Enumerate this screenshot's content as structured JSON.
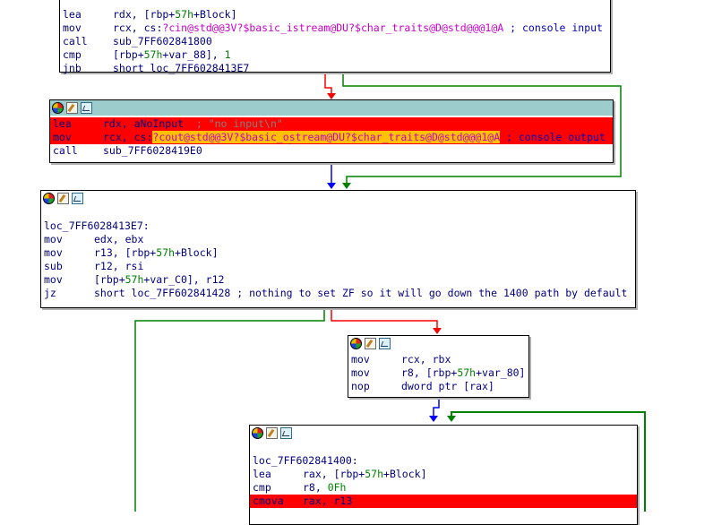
{
  "colors": {
    "red_edge": "#ff0000",
    "green_edge": "#008000",
    "blue_edge": "#0000ff",
    "highlight": "#ffc000",
    "red_line": "#ff0000",
    "header_teal": "#9ccccc"
  },
  "header_icons": [
    "color-icon",
    "rename-icon",
    "graph-overview-icon"
  ],
  "block1": {
    "lines": [
      {
        "mn": "lea",
        "a": "rdx, [rbp+",
        "n": "57h",
        "b": "+Block]"
      },
      {
        "mn": "mov",
        "a": "rcx, cs:",
        "s": "?cin@std@@3V?$basic_istream@DU?$char_traits@D@std@@@1@A",
        "c": " ; console input"
      },
      {
        "mn": "call",
        "a": "sub_7FF602841800"
      },
      {
        "mn": "cmp",
        "a": "[rbp+",
        "n": "57h",
        "b": "+var_88], ",
        "n2": "1"
      },
      {
        "mn": "jnb",
        "a": "short loc_7FF6028413E7"
      }
    ]
  },
  "block2": {
    "l1": {
      "mn": "lea",
      "a": "rdx, aNoInput",
      "c": "  ; \"no input\\n\""
    },
    "l2": {
      "mn": "mov",
      "a": "rcx, cs:",
      "s1": "?cout@std@@3V?$basic_o",
      "s2": "stream@DU?$char_traits@D@std@@@1@A",
      "c": " ; console output"
    },
    "l3": {
      "mn": "call",
      "a": "sub_7FF6028419E0"
    }
  },
  "block3": {
    "label": "loc_7FF6028413E7:",
    "lines": [
      {
        "mn": "mov",
        "a": "edx, ebx"
      },
      {
        "mn": "mov",
        "a": "r13, [rbp+",
        "n": "57h",
        "b": "+Block]"
      },
      {
        "mn": "sub",
        "a": "r12, rsi"
      },
      {
        "mn": "mov",
        "a": "[rbp+",
        "n": "57h",
        "b": "+var_C0], r12"
      },
      {
        "mn": "jz",
        "a": "short loc_7FF602841428 ; nothing to set ZF so it will go down the 1400 path by default"
      }
    ]
  },
  "block4": {
    "lines": [
      {
        "mn": "mov",
        "a": "rcx, rbx"
      },
      {
        "mn": "mov",
        "a": "r8, [rbp+",
        "n": "57h",
        "b": "+var_80]"
      },
      {
        "mn": "nop",
        "a": "dword ptr [rax]"
      }
    ]
  },
  "block5": {
    "label": "loc_7FF602841400:",
    "lines": [
      {
        "mn": "lea",
        "a": "rax, [rbp+",
        "n": "57h",
        "b": "+Block]"
      },
      {
        "mn": "cmp",
        "a": "r8, ",
        "n": "0Fh",
        "b": ""
      },
      {
        "mn": "cmova",
        "a": "rax, r13",
        "red": true
      }
    ]
  }
}
